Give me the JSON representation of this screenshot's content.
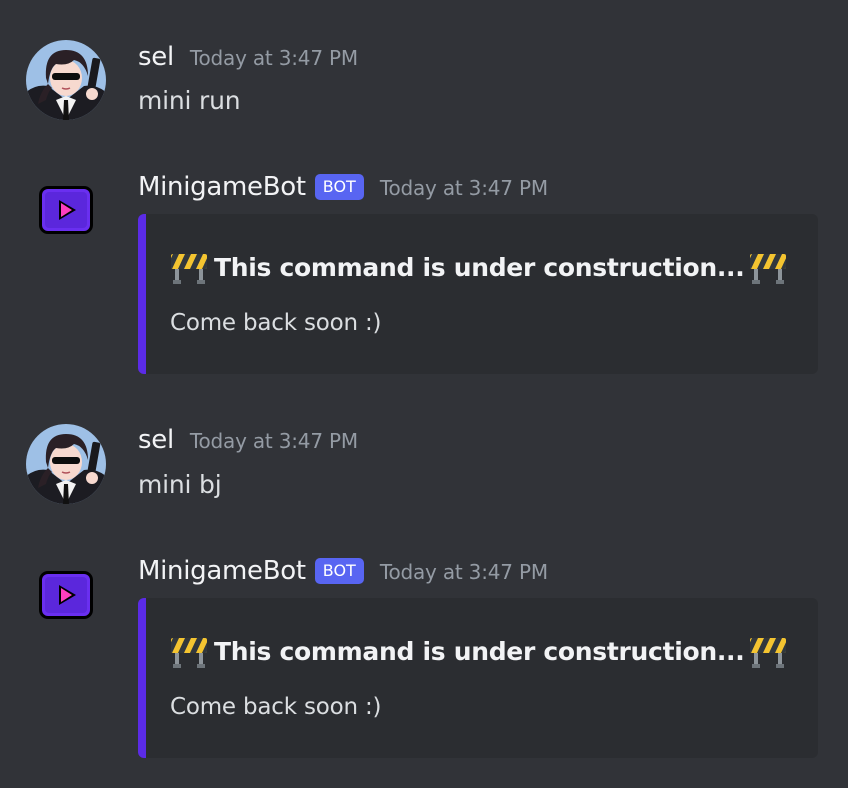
{
  "colors": {
    "background": "#313338",
    "embed_background": "#2b2d31",
    "embed_accent": "#5b2be6",
    "bot_badge": "#5865f2",
    "timestamp": "#949ba4"
  },
  "messages": [
    {
      "author": "sel",
      "timestamp": "Today at 3:47 PM",
      "text": "mini run",
      "avatar_icon": "anime-character-avatar"
    },
    {
      "author": "MinigameBot",
      "badge": "BOT",
      "timestamp": "Today at 3:47 PM",
      "avatar_icon": "play-button-icon",
      "embed": {
        "title": "This command is under construction...",
        "title_icon": "construction-barrier-icon",
        "description": "Come back soon :)"
      }
    },
    {
      "author": "sel",
      "timestamp": "Today at 3:47 PM",
      "text": "mini bj",
      "avatar_icon": "anime-character-avatar"
    },
    {
      "author": "MinigameBot",
      "badge": "BOT",
      "timestamp": "Today at 3:47 PM",
      "avatar_icon": "play-button-icon",
      "embed": {
        "title": "This command is under construction...",
        "title_icon": "construction-barrier-icon",
        "description": "Come back soon :)"
      }
    }
  ]
}
